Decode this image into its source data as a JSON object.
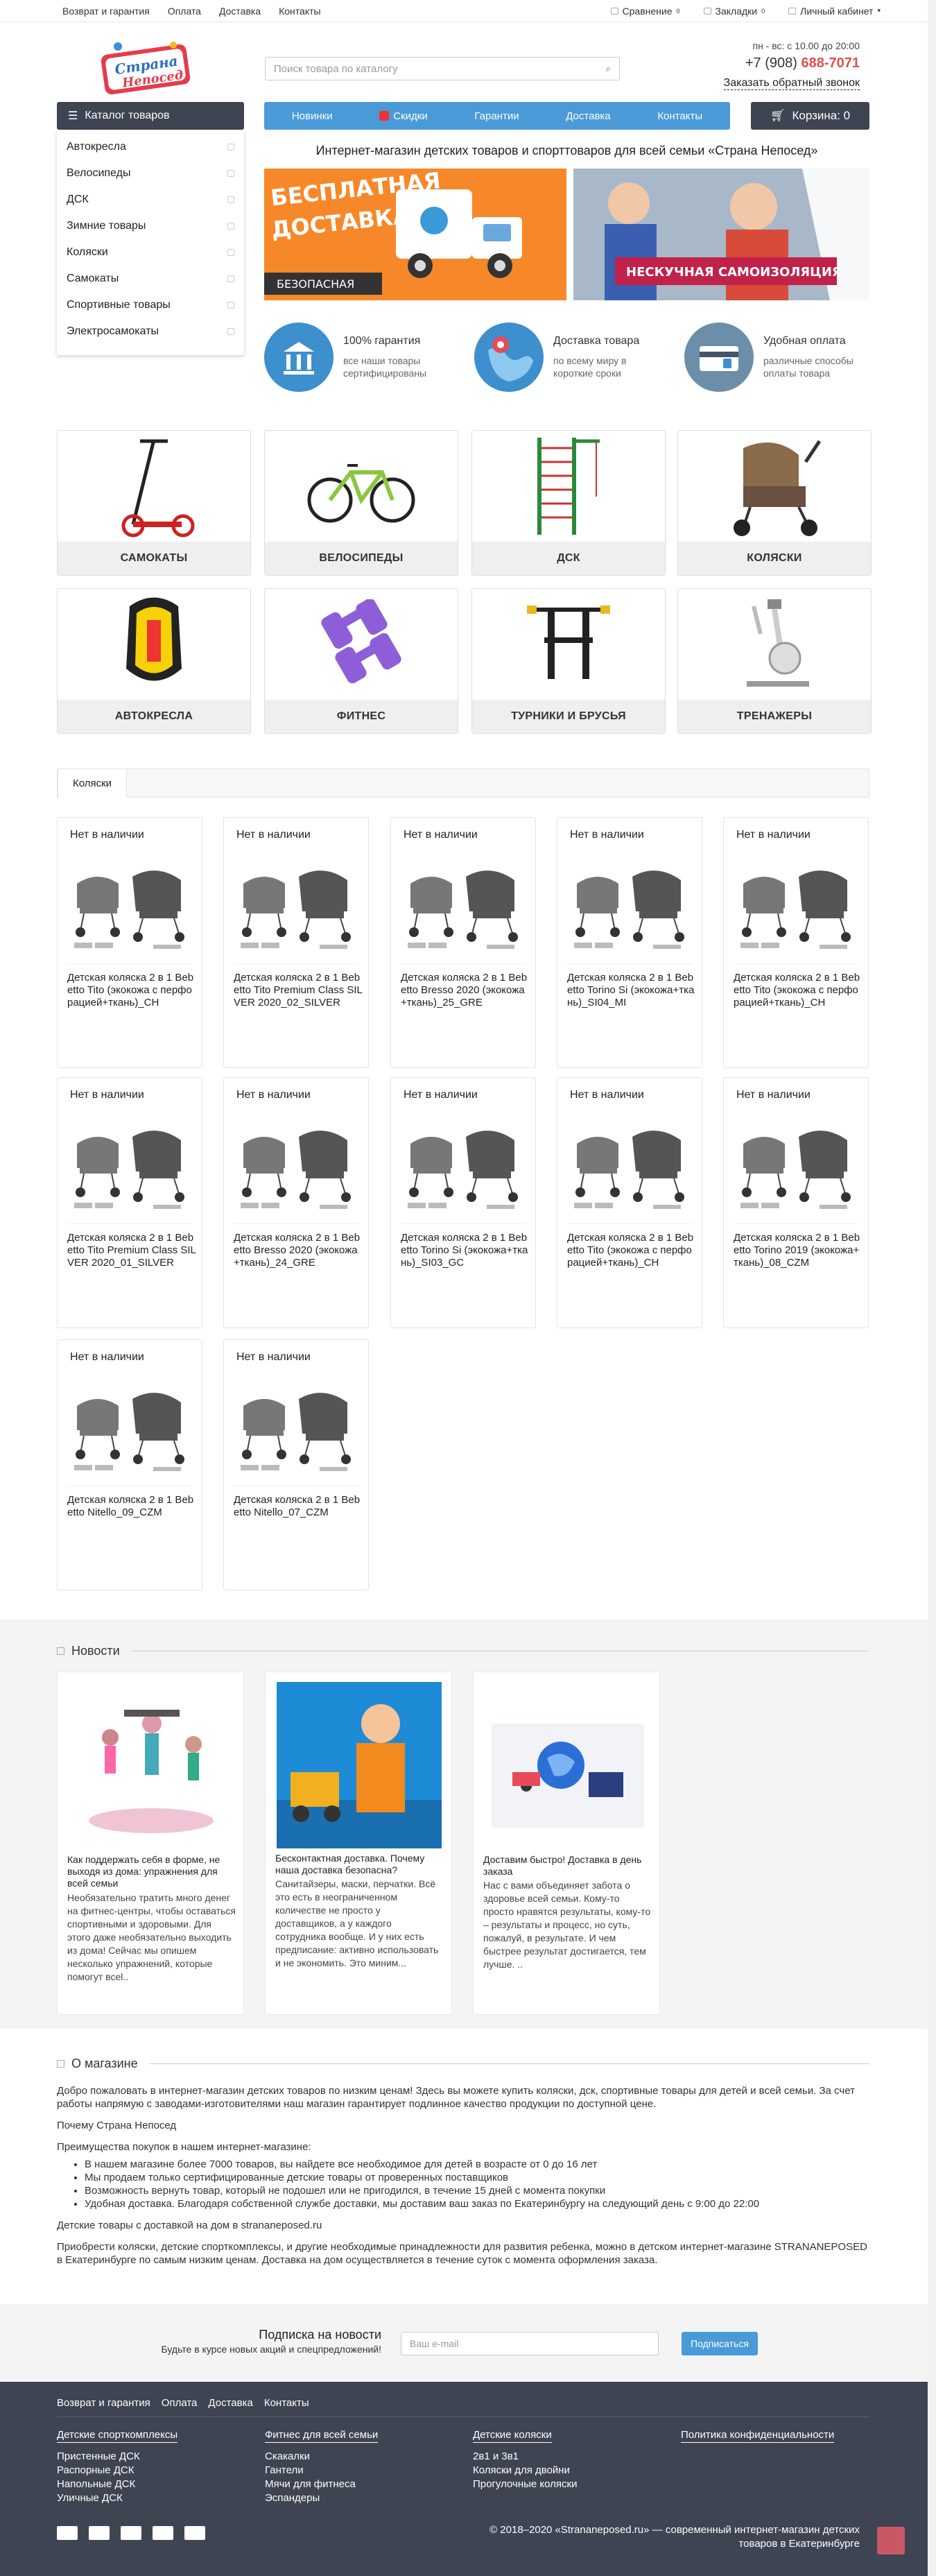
{
  "topbar": {
    "links": [
      "Возврат и гарантия",
      "Оплата",
      "Доставка",
      "Контакты"
    ],
    "compare": "Сравнение",
    "compare_count": "0",
    "bookmarks": "Закладки",
    "bookmarks_count": "0",
    "account": "Личный кабинет"
  },
  "header": {
    "logo_text_1": "Страна",
    "logo_text_2": "Непосед",
    "search_placeholder": "Поиск товара по каталогу",
    "hours": "пн - вс: с 10.00 до 20:00",
    "phone_prefix": "+7 (908)",
    "phone_main": "688-7071",
    "callback": "Заказать обратный звонок"
  },
  "nav": {
    "catalog_label": "Каталог товаров",
    "items": [
      "Новинки",
      "Скидки",
      "Гарантии",
      "Доставка",
      "Контакты"
    ],
    "cart_label": "Корзина: 0"
  },
  "catalog": [
    "Автокресла",
    "Велосипеды",
    "ДСК",
    "Зимние товары",
    "Коляски",
    "Самокаты",
    "Спортивные товары",
    "Электросамокаты"
  ],
  "hero": {
    "tagline": "Интернет-магазин детских товаров и спорттоваров для всей семьи «Страна Непосед»",
    "banner1_line1": "БЕСПЛАТНАЯ",
    "banner1_line2": "ДОСТАВКА",
    "banner1_tag": "БЕЗОПАСНАЯ",
    "banner2_tag": "НЕСКУЧНАЯ САМОИЗОЛЯЦИЯ"
  },
  "features": [
    {
      "title": "100% гарантия",
      "text": "все наши товары сертифицированы",
      "color": "#4a9ad8"
    },
    {
      "title": "Доставка товара",
      "text": "по всему миру в короткие сроки",
      "color": "#4a9ad8"
    },
    {
      "title": "Удобная оплата",
      "text": "различные способы оплаты товара",
      "color": "#6a8fa8"
    }
  ],
  "categories": [
    "САМОКАТЫ",
    "ВЕЛОСИПЕДЫ",
    "ДСК",
    "КОЛЯСКИ",
    "АВТОКРЕСЛА",
    "ФИТНЕС",
    "ТУРНИКИ И БРУСЬЯ",
    "ТРЕНАЖЕРЫ"
  ],
  "products_tab": "Коляски",
  "products": [
    {
      "status": "Нет в наличии",
      "name": "Детская коляска 2 в 1 Bebetto Tito (экокожа с перфорацией+ткань)_CH"
    },
    {
      "status": "Нет в наличии",
      "name": "Детская коляска 2 в 1 Bebetto Tito Premium Class SILVER 2020_02_SILVER"
    },
    {
      "status": "Нет в наличии",
      "name": "Детская коляска 2 в 1 Bebetto Bresso 2020 (экокожа+ткань)_25_GRE"
    },
    {
      "status": "Нет в наличии",
      "name": "Детская коляска 2 в 1 Bebetto Torino Si (экокожа+ткань)_SI04_MI"
    },
    {
      "status": "Нет в наличии",
      "name": "Детская коляска 2 в 1 Bebetto Tito (экокожа с перфорацией+ткань)_CH"
    },
    {
      "status": "Нет в наличии",
      "name": "Детская коляска 2 в 1 Bebetto Tito Premium Class SILVER 2020_01_SILVER"
    },
    {
      "status": "Нет в наличии",
      "name": "Детская коляска 2 в 1 Bebetto Bresso 2020 (экокожа+ткань)_24_GRE"
    },
    {
      "status": "Нет в наличии",
      "name": "Детская коляска 2 в 1 Bebetto Torino Si (экокожа+ткань)_SI03_GC"
    },
    {
      "status": "Нет в наличии",
      "name": "Детская коляска 2 в 1 Bebetto Tito (экокожа с перфорацией+ткань)_CH"
    },
    {
      "status": "Нет в наличии",
      "name": "Детская коляска 2 в 1 Bebetto Torino 2019 (экокожа+ткань)_08_CZM"
    },
    {
      "status": "Нет в наличии",
      "name": "Детская коляска 2 в 1 Bebetto Nitello_09_CZM"
    },
    {
      "status": "Нет в наличии",
      "name": "Детская коляска 2 в 1 Bebetto Nitello_07_CZM"
    }
  ],
  "news_title": "Новости",
  "news": [
    {
      "title": "Как поддержать себя в форме, не выходя из дома: упражнения для всей семьи",
      "text": "Необязательно тратить много денег на фитнес-центры, чтобы оставаться спортивными и здоровыми. Для этого даже необязательно выходить из дома! Сейчас мы опишем несколько упражнений, которые помогут всеl.."
    },
    {
      "title": "Бесконтактная доставка. Почему наша доставка безопасна?",
      "text": "Санитайзеры, маски, перчатки. Всё это есть в неограниченном количестве не просто у доставщиков, а у каждого сотрудника вообще. И у них есть предписание: активно использовать и не экономить. Это миним..."
    },
    {
      "title": "Доставим быстро! Доставка в день заказа",
      "text": "Нас с вами объединяет забота о здоровье всей семьи. Кому-то просто нравятся результаты, кому-то – результаты и процесс, но суть, пожалуй, в результате. И чем быстрее результат достигается, тем лучше. .."
    }
  ],
  "about": {
    "title": "О магазине",
    "intro": "Добро пожаловать в интернет-магазин детских товаров по низким ценам! Здесь вы можете купить коляски, дск, спортивные товары для детей и всей семьи. За счет работы напрямую с заводами-изготовителями наш магазин гарантирует подлинное качество продукции по доступной цене.",
    "why": "Почему Страна Непосед",
    "adv_title": "Преимущества покупок в нашем интернет-магазине:",
    "adv": [
      "В нашем магазине более 7000 товаров, вы найдете все необходимое для детей в возрасте от 0 до 16 лет",
      "Мы продаем только сертифицированные детские товары от проверенных поставщиков",
      "Возможность вернуть товар, который не подошел или не пригодился, в течение 15 дней с момента покупки",
      "Удобная доставка. Благодаря собственной службе доставки, мы доставим ваш заказ по Екатеринбургу на следующий день с 9:00 до 22:00"
    ],
    "delivery": "Детские товары с доставкой на дом в strananeposed.ru",
    "outro": "Приобрести коляски, детские спорткомплексы, и другие необходимые принадлежности для развития ребенка, можно в детском интернет-магазине STRANANEPOSED в Екатеринбурге по самым низким ценам. Доставка на дом осуществляется в течение суток с момента оформления заказа."
  },
  "subscribe": {
    "title": "Подписка на новости",
    "subtitle": "Будьте в курсе новых акций и спецпредложений!",
    "placeholder": "Ваш e-mail",
    "button": "Подписаться"
  },
  "footer": {
    "nav": [
      "Возврат и гарантия",
      "Оплата",
      "Доставка",
      "Контакты"
    ],
    "cols": [
      {
        "title": "Детские спорткомплексы",
        "items": [
          "Пристенные ДСК",
          "Распорные ДСК",
          "Напольные ДСК",
          "Уличные ДСК"
        ]
      },
      {
        "title": "Фитнес для всей семьи",
        "items": [
          "Скакалки",
          "Гантели",
          "Мячи для фитнеса",
          "Эспандеры"
        ]
      },
      {
        "title": "Детские коляски",
        "items": [
          "2в1 и 3в1",
          "Коляски для двойни",
          "Прогулочные коляски"
        ]
      },
      {
        "title": "Политика конфиденциальности",
        "items": []
      }
    ],
    "copyright": "© 2018–2020 «Strananeposed.ru» — современный интернет-магазин детских товаров в Екатеринбурге"
  }
}
